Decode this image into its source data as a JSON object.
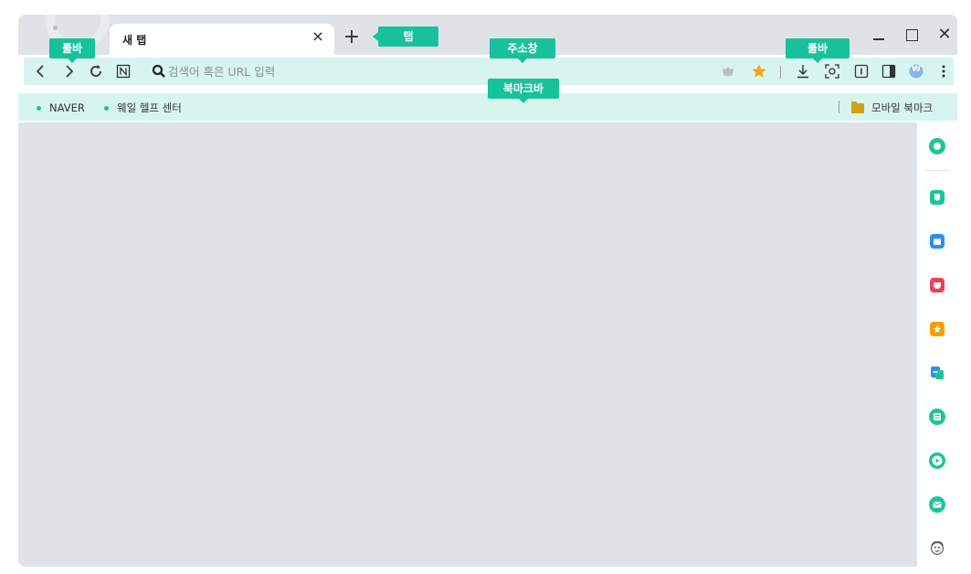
{
  "tab": {
    "title": "새 탭",
    "close_glyph": "×",
    "new_tab_glyph": "+"
  },
  "window_controls": {
    "close_glyph": "✕"
  },
  "address_bar": {
    "placeholder": "검색어 혹은 URL 입력",
    "value": ""
  },
  "bookmarks": {
    "items": [
      {
        "label": "NAVER"
      },
      {
        "label": "웨일 헬프 센터"
      }
    ],
    "mobile_folder": "모바일 북마크"
  },
  "callouts": {
    "toolbar_left": "툴바",
    "tab": "탭",
    "address_bar": "주소창",
    "toolbar_right": "툴바",
    "bookmark_bar": "북마크바"
  },
  "profile": {
    "initial": "W"
  },
  "icons": {
    "toolbar_left": [
      "back-icon",
      "forward-icon",
      "reload-icon",
      "naver-home-icon"
    ],
    "toolbar_right": [
      "whale-shield-icon",
      "bookmark-star-icon",
      "download-icon",
      "capture-icon",
      "reader-icon",
      "sidebar-toggle-icon",
      "profile-avatar-icon",
      "more-menu-icon"
    ],
    "sidebar": [
      "green-dot-app-icon",
      "chat-bubble-icon",
      "calendar-icon",
      "pocket-icon",
      "star-favorite-icon",
      "translate-icon",
      "memo-icon",
      "video-play-icon",
      "mail-icon",
      "profile-face-icon"
    ]
  },
  "colors": {
    "accent": "#17c29a",
    "highlight": "#d7f4ee",
    "frame": "#dfe3e8",
    "star": "#f5a400",
    "folder": "#d4a017"
  }
}
